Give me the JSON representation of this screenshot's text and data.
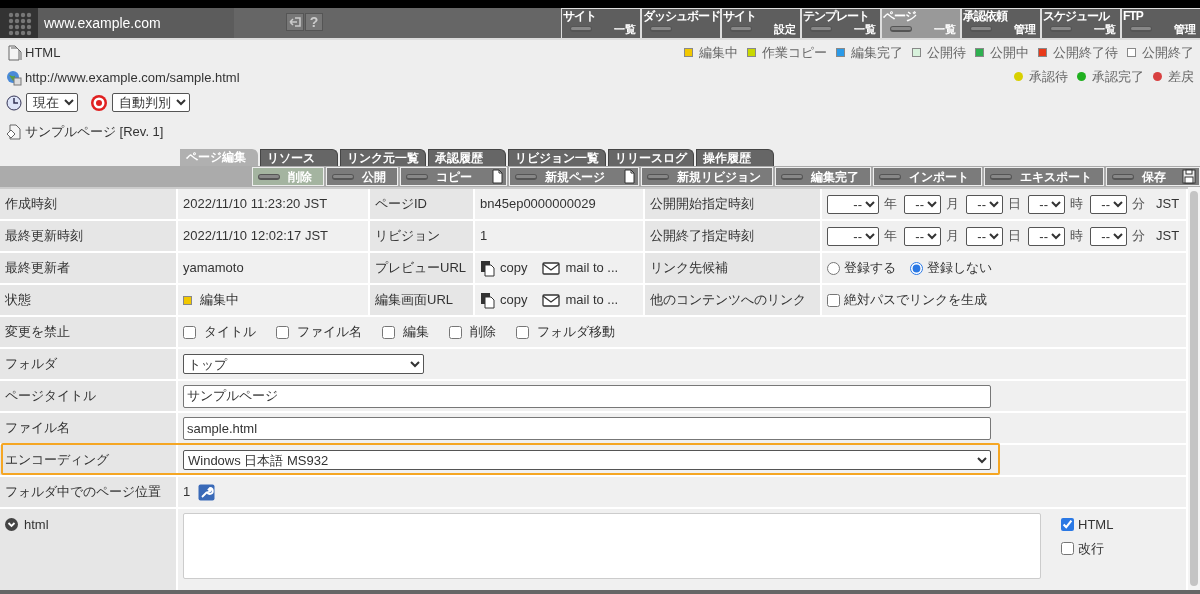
{
  "header": {
    "site": "www.example.com",
    "help": "?",
    "nav": [
      {
        "top": "サイト",
        "bottom": "一覧",
        "selected": false
      },
      {
        "top": "ダッシュボード",
        "selected": false
      },
      {
        "top": "サイト",
        "bottom": "設定",
        "selected": false
      },
      {
        "top": "テンプレート",
        "bottom": "一覧",
        "selected": false
      },
      {
        "top": "ページ",
        "bottom": "一覧",
        "selected": true
      },
      {
        "top": "承認依頼",
        "bottom": "管理",
        "selected": false
      },
      {
        "top": "スケジュール",
        "bottom": "一覧",
        "selected": false
      },
      {
        "top": "FTP",
        "bottom": "管理",
        "selected": false
      }
    ]
  },
  "info": {
    "type": "HTML",
    "url": "http://www.example.com/sample.html",
    "time_select": "現在",
    "detect_select": "自動判別",
    "page": "サンプルページ [Rev. 1]"
  },
  "status_legend": [
    {
      "label": "編集中",
      "color": "#f2c800"
    },
    {
      "label": "作業コピー",
      "color": "#c8d800"
    },
    {
      "label": "編集完了",
      "color": "#2a9ae8"
    },
    {
      "label": "公開待",
      "color": "#d8f2dc"
    },
    {
      "label": "公開中",
      "color": "#2eb050"
    },
    {
      "label": "公開終了待",
      "color": "#e83a1a"
    },
    {
      "label": "公開終了",
      "color": "#ffffff"
    }
  ],
  "approval_legend": [
    {
      "label": "承認待",
      "color": "#d8d000"
    },
    {
      "label": "承認完了",
      "color": "#20b020"
    },
    {
      "label": "差戻",
      "color": "#d84040"
    }
  ],
  "tabs": [
    {
      "label": "ページ編集",
      "selected": true
    },
    {
      "label": "リソース",
      "selected": false
    },
    {
      "label": "リンク元一覧",
      "selected": false
    },
    {
      "label": "承認履歴",
      "selected": false
    },
    {
      "label": "リビジョン一覧",
      "selected": false
    },
    {
      "label": "リリースログ",
      "selected": false
    },
    {
      "label": "操作履歴",
      "selected": false
    }
  ],
  "toolbar": [
    {
      "label": "削除",
      "selected": true
    },
    {
      "label": "公開",
      "selected": false
    },
    {
      "label": "コピー",
      "selected": false,
      "kind": "document"
    },
    {
      "label": "新規ページ",
      "selected": false,
      "kind": "document"
    },
    {
      "label": "新規リビジョン",
      "selected": false
    },
    {
      "label": "編集完了",
      "selected": false
    },
    {
      "label": "インポート",
      "selected": false
    },
    {
      "label": "エキスポート",
      "selected": false
    },
    {
      "label": "保存",
      "selected": false,
      "kind": "disk"
    }
  ],
  "meta_rows": [
    [
      {
        "label": "作成時刻",
        "value": {
          "kind": "text",
          "text": "2022/11/10 11:23:20 JST"
        }
      },
      {
        "label": "ページID",
        "value": {
          "kind": "text",
          "text": "bn45ep0000000029"
        }
      },
      {
        "label": "公開開始指定時刻",
        "value": {
          "kind": "datetime",
          "fields": [
            {
              "value": "--",
              "unit": "年"
            },
            {
              "value": "--",
              "unit": "月"
            },
            {
              "value": "--",
              "unit": "日"
            },
            {
              "value": "--",
              "unit": "時"
            },
            {
              "value": "--",
              "unit": "分"
            }
          ],
          "zone": "JST"
        }
      }
    ],
    [
      {
        "label": "最終更新時刻",
        "value": {
          "kind": "text",
          "text": "2022/11/10 12:02:17 JST"
        }
      },
      {
        "label": "リビジョン",
        "value": {
          "kind": "text",
          "text": "1"
        }
      },
      {
        "label": "公開終了指定時刻",
        "value": {
          "kind": "datetime",
          "fields": [
            {
              "value": "--",
              "unit": "年"
            },
            {
              "value": "--",
              "unit": "月"
            },
            {
              "value": "--",
              "unit": "日"
            },
            {
              "value": "--",
              "unit": "時"
            },
            {
              "value": "--",
              "unit": "分"
            }
          ],
          "zone": "JST"
        }
      }
    ],
    [
      {
        "label": "最終更新者",
        "value": {
          "kind": "text",
          "text": "yamamoto"
        }
      },
      {
        "label": "プレビューURL",
        "value": {
          "kind": "links",
          "copy": "copy",
          "mail": "mail to ..."
        }
      },
      {
        "label": "リンク先候補",
        "value": {
          "kind": "radios",
          "options": [
            {
              "label": "登録する",
              "selected": false
            },
            {
              "label": "登録しない",
              "selected": true
            }
          ]
        }
      }
    ],
    [
      {
        "label": "状態",
        "value": {
          "kind": "status",
          "text": "編集中",
          "color": "#f2c800"
        }
      },
      {
        "label": "編集画面URL",
        "value": {
          "kind": "links",
          "copy": "copy",
          "mail": "mail to ..."
        }
      },
      {
        "label": "他のコンテンツへのリンク",
        "value": {
          "kind": "checkbox",
          "label": "絶対パスでリンクを生成",
          "checked": false
        }
      }
    ]
  ],
  "form_rows": [
    {
      "label": "変更を禁止",
      "kind": "checkboxes",
      "options": [
        {
          "label": "タイトル",
          "checked": false
        },
        {
          "label": "ファイル名",
          "checked": false
        },
        {
          "label": "編集",
          "checked": false
        },
        {
          "label": "削除",
          "checked": false
        },
        {
          "label": "フォルダ移動",
          "checked": false
        }
      ]
    },
    {
      "label": "フォルダ",
      "kind": "select",
      "value": "トップ",
      "wide": false,
      "focused": false
    },
    {
      "label": "ページタイトル",
      "kind": "input",
      "value": "サンプルページ"
    },
    {
      "label": "ファイル名",
      "kind": "input",
      "value": "sample.html"
    },
    {
      "label": "エンコーディング",
      "kind": "select",
      "value": "Windows 日本語 MS932",
      "wide": true,
      "focused": true
    },
    {
      "label": "フォルダ中でのページ位置",
      "kind": "position",
      "value": "1"
    },
    {
      "label": "html",
      "kind": "editor",
      "options": [
        {
          "label": "HTML",
          "checked": true
        },
        {
          "label": "改行",
          "checked": false
        }
      ]
    }
  ]
}
